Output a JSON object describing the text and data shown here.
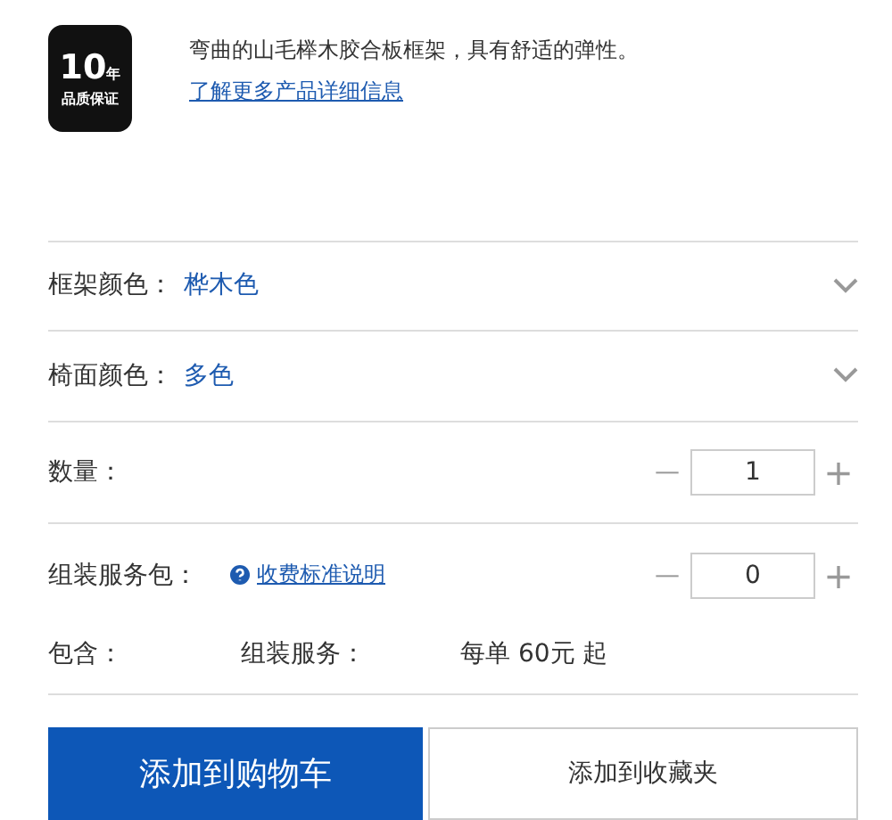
{
  "badge": {
    "number": "10",
    "unit": "年",
    "caption": "品质保证"
  },
  "description": "弯曲的山毛榉木胶合板框架，具有舒适的弹性。",
  "details_link": "了解更多产品详细信息",
  "options": [
    {
      "label": "框架颜色：",
      "value": "桦木色"
    },
    {
      "label": "椅面颜色：",
      "value": "多色"
    }
  ],
  "quantity": {
    "label": "数量：",
    "minus": "—",
    "value": "1",
    "plus": "+"
  },
  "assembly": {
    "label": "组装服务包：",
    "link": "收费标准说明",
    "minus": "—",
    "value": "0",
    "plus": "+"
  },
  "includes": {
    "label": "包含：",
    "service": "组装服务：",
    "price": "每单 60元 起"
  },
  "buttons": [
    {
      "label": "添加到购物车",
      "kind": "primary"
    },
    {
      "label": "添加到收藏夹",
      "kind": "secondary"
    }
  ]
}
